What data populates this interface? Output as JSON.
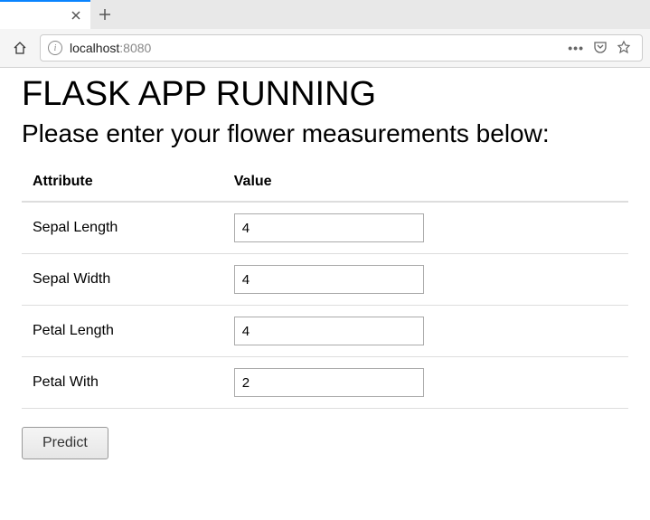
{
  "browser": {
    "url_host": "localhost",
    "url_port": ":8080"
  },
  "page": {
    "heading": "FLASK APP RUNNING",
    "subheading": "Please enter your flower measurements below:"
  },
  "table": {
    "headers": {
      "attribute": "Attribute",
      "value": "Value"
    },
    "rows": [
      {
        "label": "Sepal Length",
        "value": "4"
      },
      {
        "label": "Sepal Width",
        "value": "4"
      },
      {
        "label": "Petal Length",
        "value": "4"
      },
      {
        "label": "Petal With",
        "value": "2"
      }
    ]
  },
  "buttons": {
    "predict": "Predict"
  }
}
